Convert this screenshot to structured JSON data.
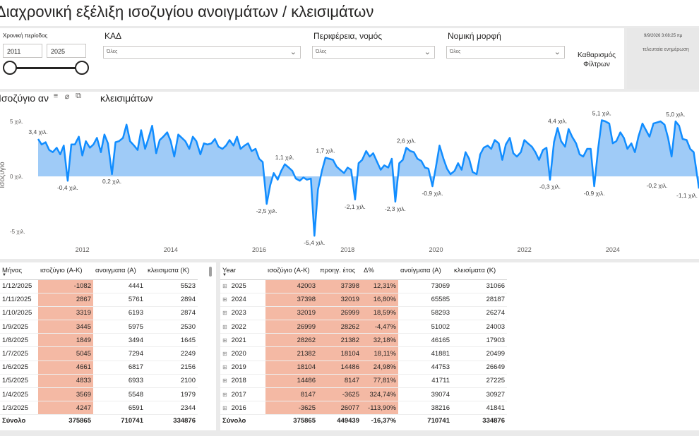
{
  "title": "Διαχρονική εξέλιξη ισοζυγίου ανοιγμάτων / κλεισιμάτων",
  "filters": {
    "period_label": "Χρονική περίοδος",
    "year_from": "2011",
    "year_to": "2025",
    "kad_label": "ΚΑΔ",
    "kad_value": "Όλες",
    "region_label": "Περιφέρεια, νομός",
    "region_value": "Όλες",
    "legal_label": "Νομική μορφή",
    "legal_value": "Όλες",
    "clear_line1": "Καθαρισμός",
    "clear_line2": "Φίλτρων"
  },
  "status": {
    "date": "9/9/2026 3:08:25 πμ",
    "updated": "τελευταία ενημέρωση"
  },
  "chart": {
    "title_part1": "Ισοζύγιο αν",
    "title_part2": "κλεισιμάτων",
    "tool_icons": [
      "filter-icon",
      "focus-icon",
      "more-icon"
    ]
  },
  "chart_data": {
    "type": "area",
    "ylabel": "Ισοζύγιο",
    "ylim": [
      -6.5,
      6
    ],
    "y_ticks": [
      5,
      0,
      -5
    ],
    "y_tick_labels": [
      "5 χιλ.",
      "0 χιλ.",
      "-5 χιλ."
    ],
    "x_ticks": [
      2012,
      2014,
      2016,
      2018,
      2020,
      2022,
      2024
    ],
    "x_range": [
      2011.0,
      2025.95
    ],
    "series_color": "#118dff",
    "fill_color": "#9fcbf7",
    "points": [
      [
        2011.0,
        3.4
      ],
      [
        2011.08,
        2.9
      ],
      [
        2011.17,
        3.1
      ],
      [
        2011.25,
        2.4
      ],
      [
        2011.33,
        2.2
      ],
      [
        2011.42,
        2.6
      ],
      [
        2011.5,
        2.0
      ],
      [
        2011.58,
        2.8
      ],
      [
        2011.67,
        -0.4
      ],
      [
        2011.75,
        2.9
      ],
      [
        2011.83,
        2.9
      ],
      [
        2011.92,
        3.6
      ],
      [
        2012.0,
        1.9
      ],
      [
        2012.08,
        3.2
      ],
      [
        2012.17,
        2.6
      ],
      [
        2012.25,
        2.9
      ],
      [
        2012.33,
        3.5
      ],
      [
        2012.42,
        2.2
      ],
      [
        2012.5,
        3.8
      ],
      [
        2012.58,
        3.0
      ],
      [
        2012.67,
        0.2
      ],
      [
        2012.75,
        3.1
      ],
      [
        2012.83,
        3.2
      ],
      [
        2012.92,
        3.5
      ],
      [
        2013.0,
        4.7
      ],
      [
        2013.08,
        3.2
      ],
      [
        2013.17,
        2.8
      ],
      [
        2013.25,
        2.4
      ],
      [
        2013.33,
        4.2
      ],
      [
        2013.42,
        2.5
      ],
      [
        2013.5,
        3.5
      ],
      [
        2013.58,
        4.6
      ],
      [
        2013.67,
        2.1
      ],
      [
        2013.75,
        3.3
      ],
      [
        2013.83,
        3.6
      ],
      [
        2013.92,
        4.0
      ],
      [
        2014.0,
        3.2
      ],
      [
        2014.08,
        1.8
      ],
      [
        2014.17,
        3.8
      ],
      [
        2014.25,
        3.5
      ],
      [
        2014.33,
        3.2
      ],
      [
        2014.42,
        2.5
      ],
      [
        2014.5,
        3.6
      ],
      [
        2014.58,
        3.2
      ],
      [
        2014.67,
        2.0
      ],
      [
        2014.75,
        3.0
      ],
      [
        2014.83,
        2.9
      ],
      [
        2014.92,
        3.0
      ],
      [
        2015.0,
        3.4
      ],
      [
        2015.08,
        2.7
      ],
      [
        2015.17,
        2.5
      ],
      [
        2015.25,
        2.8
      ],
      [
        2015.33,
        3.3
      ],
      [
        2015.42,
        2.8
      ],
      [
        2015.5,
        3.6
      ],
      [
        2015.58,
        2.5
      ],
      [
        2015.67,
        2.8
      ],
      [
        2015.75,
        3.0
      ],
      [
        2015.83,
        2.3
      ],
      [
        2015.92,
        2.5
      ],
      [
        2016.0,
        1.6
      ],
      [
        2016.08,
        1.3
      ],
      [
        2016.17,
        -2.5
      ],
      [
        2016.25,
        -0.8
      ],
      [
        2016.33,
        0.3
      ],
      [
        2016.42,
        -0.3
      ],
      [
        2016.5,
        0.5
      ],
      [
        2016.58,
        1.1
      ],
      [
        2016.67,
        0.8
      ],
      [
        2016.75,
        0.5
      ],
      [
        2016.83,
        -0.2
      ],
      [
        2016.92,
        -0.4
      ],
      [
        2017.0,
        -0.1
      ],
      [
        2017.08,
        -0.3
      ],
      [
        2017.17,
        -0.2
      ],
      [
        2017.25,
        -5.4
      ],
      [
        2017.33,
        -1.2
      ],
      [
        2017.42,
        0.5
      ],
      [
        2017.5,
        1.7
      ],
      [
        2017.58,
        1.6
      ],
      [
        2017.67,
        1.5
      ],
      [
        2017.75,
        0.9
      ],
      [
        2017.83,
        0.6
      ],
      [
        2017.92,
        0.3
      ],
      [
        2018.0,
        0.8
      ],
      [
        2018.08,
        0.6
      ],
      [
        2018.17,
        -2.1
      ],
      [
        2018.25,
        1.2
      ],
      [
        2018.33,
        1.5
      ],
      [
        2018.42,
        2.3
      ],
      [
        2018.5,
        1.8
      ],
      [
        2018.58,
        2.1
      ],
      [
        2018.67,
        1.3
      ],
      [
        2018.75,
        0.6
      ],
      [
        2018.83,
        1.0
      ],
      [
        2018.92,
        0.8
      ],
      [
        2019.0,
        1.6
      ],
      [
        2019.08,
        -2.3
      ],
      [
        2019.17,
        1.2
      ],
      [
        2019.25,
        1.5
      ],
      [
        2019.33,
        2.6
      ],
      [
        2019.42,
        2.3
      ],
      [
        2019.5,
        2.2
      ],
      [
        2019.58,
        1.6
      ],
      [
        2019.67,
        1.4
      ],
      [
        2019.75,
        0.8
      ],
      [
        2019.83,
        0.7
      ],
      [
        2019.92,
        -0.9
      ],
      [
        2020.0,
        0.9
      ],
      [
        2020.08,
        2.8
      ],
      [
        2020.17,
        1.6
      ],
      [
        2020.25,
        0.7
      ],
      [
        2020.33,
        0.2
      ],
      [
        2020.42,
        0.5
      ],
      [
        2020.5,
        1.2
      ],
      [
        2020.58,
        0.6
      ],
      [
        2020.67,
        2.2
      ],
      [
        2020.75,
        1.6
      ],
      [
        2020.83,
        0.4
      ],
      [
        2020.92,
        0.2
      ],
      [
        2021.0,
        2.0
      ],
      [
        2021.08,
        2.6
      ],
      [
        2021.17,
        2.8
      ],
      [
        2021.25,
        2.5
      ],
      [
        2021.33,
        3.3
      ],
      [
        2021.42,
        3.0
      ],
      [
        2021.5,
        1.5
      ],
      [
        2021.58,
        2.9
      ],
      [
        2021.67,
        3.5
      ],
      [
        2021.75,
        2.1
      ],
      [
        2021.83,
        1.8
      ],
      [
        2021.92,
        2.2
      ],
      [
        2022.0,
        3.3
      ],
      [
        2022.08,
        3.0
      ],
      [
        2022.17,
        2.7
      ],
      [
        2022.25,
        2.2
      ],
      [
        2022.33,
        1.5
      ],
      [
        2022.42,
        2.4
      ],
      [
        2022.5,
        2.6
      ],
      [
        2022.58,
        -0.3
      ],
      [
        2022.67,
        3.1
      ],
      [
        2022.75,
        4.4
      ],
      [
        2022.83,
        3.2
      ],
      [
        2022.92,
        2.7
      ],
      [
        2023.0,
        4.3
      ],
      [
        2023.08,
        3.6
      ],
      [
        2023.17,
        3.0
      ],
      [
        2023.25,
        2.0
      ],
      [
        2023.33,
        1.8
      ],
      [
        2023.42,
        2.5
      ],
      [
        2023.5,
        2.5
      ],
      [
        2023.58,
        -0.9
      ],
      [
        2023.67,
        2.6
      ],
      [
        2023.75,
        5.1
      ],
      [
        2023.83,
        5.0
      ],
      [
        2023.92,
        4.8
      ],
      [
        2024.0,
        3.0
      ],
      [
        2024.08,
        3.2
      ],
      [
        2024.17,
        4.0
      ],
      [
        2024.25,
        3.5
      ],
      [
        2024.33,
        2.5
      ],
      [
        2024.42,
        3.0
      ],
      [
        2024.5,
        2.2
      ],
      [
        2024.58,
        3.6
      ],
      [
        2024.67,
        4.8
      ],
      [
        2024.75,
        4.2
      ],
      [
        2024.83,
        3.6
      ],
      [
        2024.92,
        4.8
      ],
      [
        2025.0,
        4.9
      ],
      [
        2025.08,
        5.0
      ],
      [
        2025.17,
        4.7
      ],
      [
        2025.25,
        3.5
      ],
      [
        2025.33,
        1.8
      ],
      [
        2025.42,
        5.0
      ],
      [
        2025.5,
        4.6
      ],
      [
        2025.58,
        3.4
      ],
      [
        2025.67,
        3.3
      ],
      [
        2025.75,
        2.5
      ],
      [
        2025.83,
        2.2
      ],
      [
        2025.95,
        -1.1
      ]
    ],
    "data_labels": [
      {
        "x": 2011.0,
        "y": 3.4,
        "text": "3,4 χιλ.",
        "pos": "above"
      },
      {
        "x": 2011.67,
        "y": -0.4,
        "text": "-0,4 χιλ.",
        "pos": "below"
      },
      {
        "x": 2012.67,
        "y": 0.2,
        "text": "0,2 χιλ.",
        "pos": "below"
      },
      {
        "x": 2016.17,
        "y": -2.5,
        "text": "-2,5 χιλ.",
        "pos": "below"
      },
      {
        "x": 2016.58,
        "y": 1.1,
        "text": "1,1 χιλ.",
        "pos": "above"
      },
      {
        "x": 2017.25,
        "y": -5.4,
        "text": "-5,4 χιλ.",
        "pos": "below"
      },
      {
        "x": 2017.5,
        "y": 1.7,
        "text": "1,7 χιλ.",
        "pos": "above"
      },
      {
        "x": 2018.17,
        "y": -2.1,
        "text": "-2,1 χιλ.",
        "pos": "below"
      },
      {
        "x": 2019.08,
        "y": -2.3,
        "text": "-2,3 χιλ.",
        "pos": "below"
      },
      {
        "x": 2019.33,
        "y": 2.6,
        "text": "2,6 χιλ.",
        "pos": "above"
      },
      {
        "x": 2019.92,
        "y": -0.9,
        "text": "-0,9 χιλ.",
        "pos": "below"
      },
      {
        "x": 2022.58,
        "y": -0.3,
        "text": "-0,3 χιλ.",
        "pos": "below"
      },
      {
        "x": 2022.75,
        "y": 4.4,
        "text": "4,4 χιλ.",
        "pos": "above"
      },
      {
        "x": 2023.58,
        "y": -0.9,
        "text": "-0,9 χιλ.",
        "pos": "below"
      },
      {
        "x": 2023.75,
        "y": 5.1,
        "text": "5,1 χιλ.",
        "pos": "above"
      },
      {
        "x": 2025.0,
        "y": -0.2,
        "text": "-0,2 χιλ.",
        "pos": "below"
      },
      {
        "x": 2025.42,
        "y": 5.0,
        "text": "5,0 χιλ.",
        "pos": "above"
      },
      {
        "x": 2025.95,
        "y": -1.1,
        "text": "-1,1 χιλ.",
        "pos": "below"
      }
    ]
  },
  "monthly_table": {
    "headers": [
      "Μήνας",
      "ισοζύγιο (Α-Κ)",
      "ανοιγματα (Α)",
      "κλεισιματα (Κ)"
    ],
    "rows": [
      [
        "1/12/2025",
        "-1082",
        "4441",
        "5523"
      ],
      [
        "1/11/2025",
        "2867",
        "5761",
        "2894"
      ],
      [
        "1/10/2025",
        "3319",
        "6193",
        "2874"
      ],
      [
        "1/9/2025",
        "3445",
        "5975",
        "2530"
      ],
      [
        "1/8/2025",
        "1849",
        "3494",
        "1645"
      ],
      [
        "1/7/2025",
        "5045",
        "7294",
        "2249"
      ],
      [
        "1/6/2025",
        "4661",
        "6817",
        "2156"
      ],
      [
        "1/5/2025",
        "4833",
        "6933",
        "2100"
      ],
      [
        "1/4/2025",
        "3569",
        "5548",
        "1979"
      ],
      [
        "1/3/2025",
        "4247",
        "6591",
        "2344"
      ]
    ],
    "total": [
      "Σύνολο",
      "375865",
      "710741",
      "334876"
    ]
  },
  "yearly_table": {
    "headers": [
      "Year",
      "ισοζύγιο (Α-Κ)",
      "προηγ. έτος",
      "Δ%",
      "ανοίγματα (Α)",
      "κλεισίματα (Κ)"
    ],
    "rows": [
      [
        "2025",
        "42003",
        "37398",
        "12,31%",
        "73069",
        "31066"
      ],
      [
        "2024",
        "37398",
        "32019",
        "16,80%",
        "65585",
        "28187"
      ],
      [
        "2023",
        "32019",
        "26999",
        "18,59%",
        "58293",
        "26274"
      ],
      [
        "2022",
        "26999",
        "28262",
        "-4,47%",
        "51002",
        "24003"
      ],
      [
        "2021",
        "28262",
        "21382",
        "32,18%",
        "46165",
        "17903"
      ],
      [
        "2020",
        "21382",
        "18104",
        "18,11%",
        "41881",
        "20499"
      ],
      [
        "2019",
        "18104",
        "14486",
        "24,98%",
        "44753",
        "26649"
      ],
      [
        "2018",
        "14486",
        "8147",
        "77,81%",
        "41711",
        "27225"
      ],
      [
        "2017",
        "8147",
        "-3625",
        "324,74%",
        "39074",
        "30927"
      ],
      [
        "2016",
        "-3625",
        "26077",
        "-113,90%",
        "38216",
        "41841"
      ]
    ],
    "total": [
      "Σύνολο",
      "375865",
      "449439",
      "-16,37%",
      "710741",
      "334876"
    ]
  }
}
